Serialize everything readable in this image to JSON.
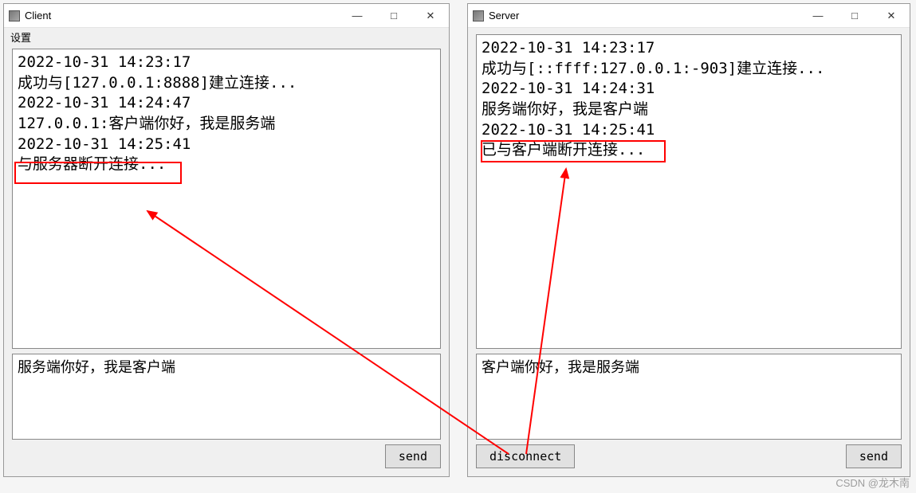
{
  "client": {
    "title": "Client",
    "menu": {
      "settings": "设置"
    },
    "log": "2022-10-31 14:23:17\n成功与[127.0.0.1:8888]建立连接...\n2022-10-31 14:24:47\n127.0.0.1:客户端你好，我是服务端\n2022-10-31 14:25:41\n与服务器断开连接...",
    "input_value": "服务端你好，我是客户端",
    "buttons": {
      "send": "send"
    }
  },
  "server": {
    "title": "Server",
    "log": "2022-10-31 14:23:17\n成功与[::ffff:127.0.0.1:-903]建立连接...\n2022-10-31 14:24:31\n服务端你好，我是客户端\n2022-10-31 14:25:41\n已与客户端断开连接...",
    "input_value": "客户端你好，我是服务端",
    "buttons": {
      "disconnect": "disconnect",
      "send": "send"
    }
  },
  "window_controls": {
    "minimize": "—",
    "maximize": "□",
    "close": "✕"
  },
  "watermark": "CSDN @龙木南"
}
